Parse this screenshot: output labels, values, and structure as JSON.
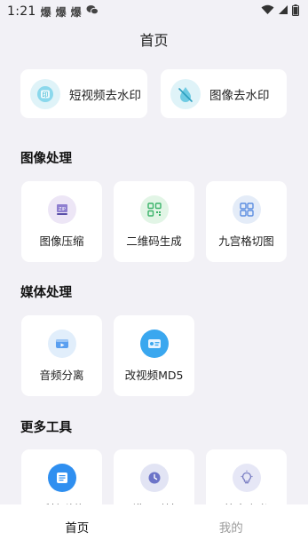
{
  "status_bar": {
    "time": "1:21",
    "notification_icons": [
      "爆",
      "爆",
      "爆"
    ],
    "icons": [
      "wechat-icon",
      "wifi-icon",
      "signal-icon",
      "battery-icon"
    ]
  },
  "header": {
    "title": "首页"
  },
  "watermark": {
    "short_video_label": "短视频去水印",
    "image_label": "图像去水印"
  },
  "sections": {
    "image": {
      "title": "图像处理",
      "items": [
        {
          "label": "图像压缩",
          "icon": "image-compress-icon"
        },
        {
          "label": "二维码生成",
          "icon": "qrcode-icon"
        },
        {
          "label": "九宫格切图",
          "icon": "grid-cut-icon"
        }
      ]
    },
    "media": {
      "title": "媒体处理",
      "items": [
        {
          "label": "音频分离",
          "icon": "audio-separate-icon"
        },
        {
          "label": "改视频MD5",
          "icon": "video-md5-icon"
        }
      ]
    },
    "more": {
      "title": "更多工具",
      "items": [
        {
          "label": "手持弹幕",
          "icon": "handheld-barrage-icon"
        },
        {
          "label": "横屏时钟",
          "icon": "clock-icon"
        },
        {
          "label": "答案之书",
          "icon": "lightbulb-icon"
        }
      ]
    }
  },
  "bottom_nav": {
    "home_label": "首页",
    "mine_label": "我的"
  },
  "colors": {
    "background": "#f2f1f6",
    "card": "#ffffff",
    "accent_blue": "#2f8ff0",
    "teal": "#31b9c9"
  }
}
